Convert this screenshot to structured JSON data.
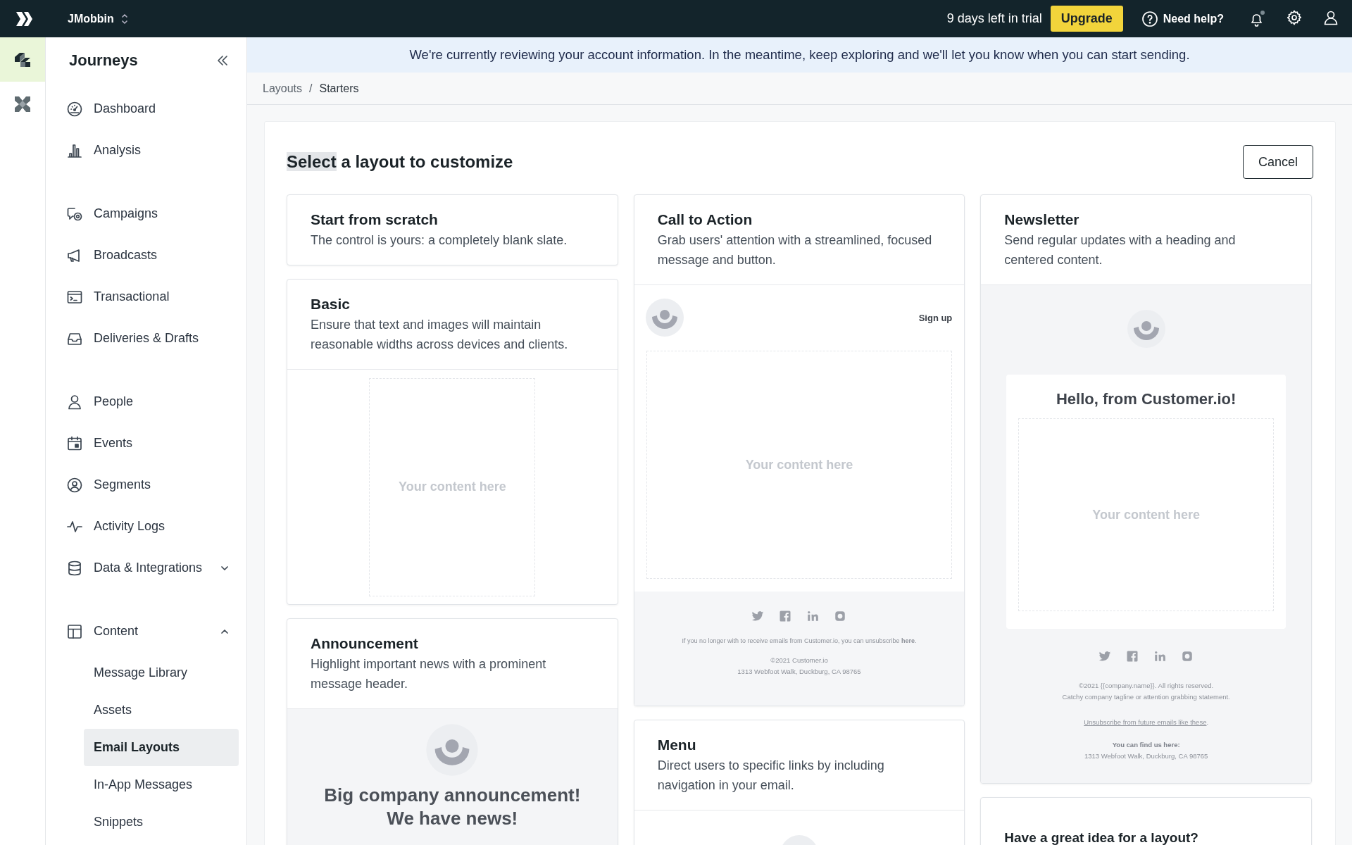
{
  "topbar": {
    "workspace": "JMobbin",
    "trial": "9 days left in trial",
    "upgrade": "Upgrade",
    "help": "Need help?",
    "notifications_unread": true
  },
  "rail": [
    {
      "selected": true
    },
    {
      "selected": false
    }
  ],
  "banner": "We're currently reviewing your account information. In the meantime, keep exploring and we'll let you know when you can start sending.",
  "sidebar": {
    "title": "Journeys",
    "groups": [
      {
        "items": [
          {
            "kind": "link",
            "label": "Dashboard",
            "selected": false
          },
          {
            "kind": "link",
            "label": "Analysis",
            "selected": false
          }
        ]
      },
      {
        "items": [
          {
            "kind": "link",
            "label": "Campaigns",
            "selected": false
          },
          {
            "kind": "link",
            "label": "Broadcasts",
            "selected": false
          },
          {
            "kind": "link",
            "label": "Transactional",
            "selected": false
          },
          {
            "kind": "link",
            "label": "Deliveries & Drafts",
            "selected": false
          }
        ]
      },
      {
        "items": [
          {
            "kind": "link",
            "label": "People",
            "selected": false
          },
          {
            "kind": "link",
            "label": "Events",
            "selected": false
          },
          {
            "kind": "link",
            "label": "Segments",
            "selected": false
          },
          {
            "kind": "link",
            "label": "Activity Logs",
            "selected": false
          },
          {
            "kind": "group",
            "label": "Data & Integrations",
            "selected": false,
            "expanded": false
          }
        ]
      },
      {
        "items": [
          {
            "kind": "group",
            "label": "Content",
            "selected": false,
            "expanded": true,
            "children": [
              {
                "label": "Message Library",
                "selected": false
              },
              {
                "label": "Assets",
                "selected": false
              },
              {
                "label": "Email Layouts",
                "selected": true
              },
              {
                "label": "In-App Messages",
                "selected": false
              },
              {
                "label": "Snippets",
                "selected": false
              }
            ]
          }
        ]
      }
    ]
  },
  "breadcrumb": {
    "items": [
      "Layouts",
      "Starters"
    ],
    "separator": "/"
  },
  "heading": {
    "selected_part": "Select",
    "rest": " a layout to customize"
  },
  "cancel": "Cancel",
  "columns": [
    {
      "cards": [
        {
          "kind": "blank",
          "title": "Start from scratch",
          "description": "The control is yours: a completely blank slate."
        },
        {
          "kind": "basic",
          "title": "Basic",
          "description": "Ensure that text and images will maintain reasonable widths across devices and clients.",
          "content_hint": "Your content here"
        },
        {
          "kind": "announcement",
          "title": "Announcement",
          "description": "Highlight important news with a prominent message header.",
          "headline_lines": [
            "Big company announcement!",
            "We have news!"
          ]
        }
      ]
    },
    {
      "cards": [
        {
          "kind": "cta",
          "title": "Call to Action",
          "description": "Grab users' attention with a streamlined, focused message and button.",
          "button": "Sign up",
          "content_hint": "Your content here",
          "unsubscribe": "If you no longer with to receive emails from Customer.io, you can unsubscribe **here**.",
          "copyright": "©2021 Customer.io",
          "address": "1313 Webfoot Walk, Duckburg, CA 98765"
        },
        {
          "kind": "menu",
          "title": "Menu",
          "description": "Direct users to specific links by including navigation in your email."
        }
      ]
    },
    {
      "cards": [
        {
          "kind": "newsletter",
          "title": "Newsletter",
          "description": "Send regular updates with a heading and centered content.",
          "greeting": "Hello, from Customer.io!",
          "content_hint": "Your content here",
          "footer_lines": [
            "©2021 {{company.name}}. All rights reserved.",
            "Catchy company tagline or attention grabbing statement."
          ],
          "unsubscribe": {
            "link": "Unsubscribe from future emails like these",
            "after": "."
          },
          "find_us": "You can find us here:",
          "address": "1313 Webfoot Walk, Duckburg, CA 98765"
        },
        {
          "kind": "idea",
          "title": "Have a great idea for a layout?"
        }
      ]
    }
  ]
}
